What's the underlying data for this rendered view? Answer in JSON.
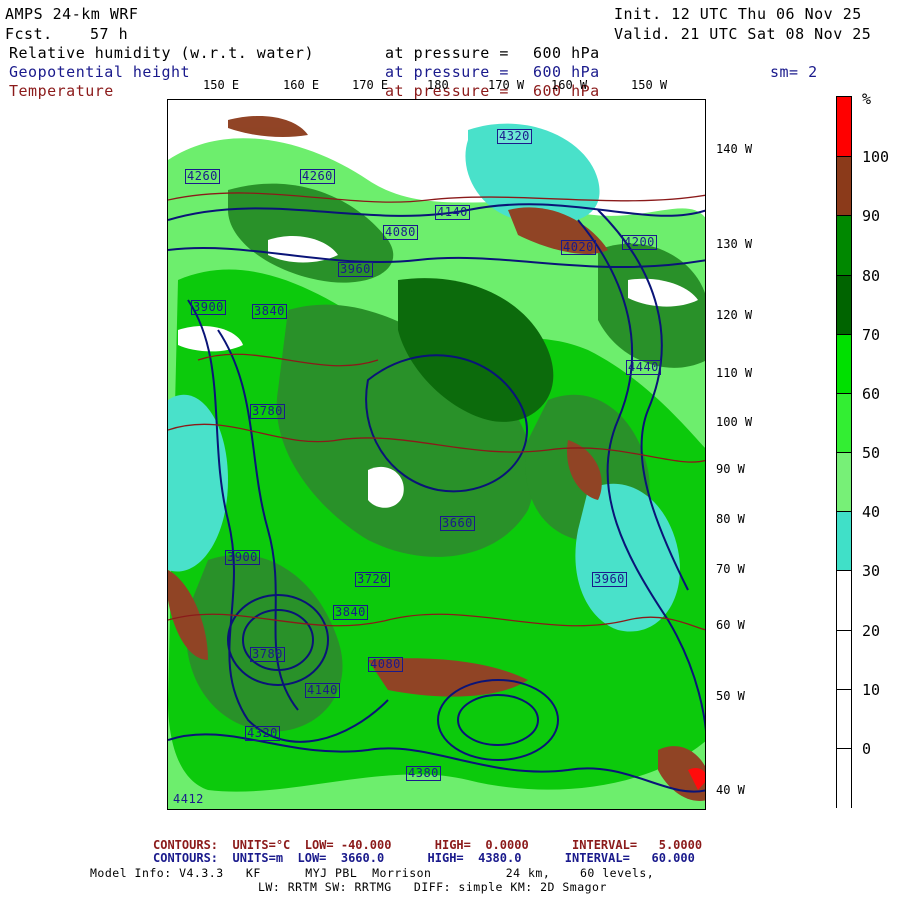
{
  "header": {
    "model": "AMPS 24-km WRF",
    "fcst_label": "Fcst.",
    "fcst_value": "57 h",
    "init": "Init. 12 UTC Thu 06 Nov 25",
    "valid": "Valid. 21 UTC Sat 08 Nov 25"
  },
  "fields": [
    {
      "name": "Relative humidity (w.r.t. water)",
      "at": "at pressure =",
      "value": "600 hPa",
      "color": "#000000"
    },
    {
      "name": "Geopotential height",
      "at": "at pressure =",
      "value": "600 hPa",
      "color": "#1a1a8c"
    },
    {
      "name": "Temperature",
      "at": "at pressure =",
      "value": "600 hPa",
      "color": "#8b1a1a"
    }
  ],
  "smoothing": "sm= 2",
  "map": {
    "lon_labels": [
      "150 E",
      "160 E",
      "170 E",
      "180",
      "170 W",
      "160 W",
      "150 W"
    ],
    "lat_labels": [
      "140 W",
      "130 W",
      "120 W",
      "110 W",
      "100 W",
      "90 W",
      "80 W",
      "70 W",
      "60 W",
      "50 W",
      "40 W"
    ],
    "height_labels": [
      "4320",
      "4260",
      "4200",
      "4080",
      "4140",
      "4020",
      "3900",
      "3840",
      "3780",
      "3720",
      "3660",
      "3960",
      "4440",
      "3900",
      "3780",
      "3840",
      "3960",
      "4080",
      "4140",
      "4200",
      "4260",
      "4320",
      "4380",
      "4412"
    ],
    "colors": {
      "background": "#ffffff",
      "cyan": "#40e0c8",
      "light_green": "#66ee66",
      "green": "#00c800",
      "dark_green": "#1e8c1e",
      "deep_green": "#006400",
      "brown": "#8b4513",
      "red": "#ff0000",
      "contour_blue": "#0a1478",
      "contour_red": "#8b1a1a"
    }
  },
  "colorbar": {
    "unit": "%",
    "labels": [
      "100",
      "90",
      "80",
      "70",
      "60",
      "50",
      "40",
      "30",
      "20",
      "10",
      "0"
    ],
    "colors": [
      "#ff0000",
      "#8b3a1a",
      "#008800",
      "#006400",
      "#00e000",
      "#33ee33",
      "#77f077",
      "#40e0c8",
      "#ffffff",
      "#ffffff",
      "#ffffff",
      "#ffffff"
    ]
  },
  "footer": {
    "line1": "CONTOURS:  UNITS=°C  LOW= -40.000      HIGH=  0.0000      INTERVAL=   5.0000",
    "line2": "CONTOURS:  UNITS=m  LOW=  3660.0      HIGH=  4380.0      INTERVAL=   60.000",
    "line3": "Model Info: V4.3.3   KF      MYJ PBL  Morrison          24 km,    60 levels,",
    "line4": "LW: RRTM SW: RRTMG   DIFF: simple KM: 2D Smagor"
  }
}
